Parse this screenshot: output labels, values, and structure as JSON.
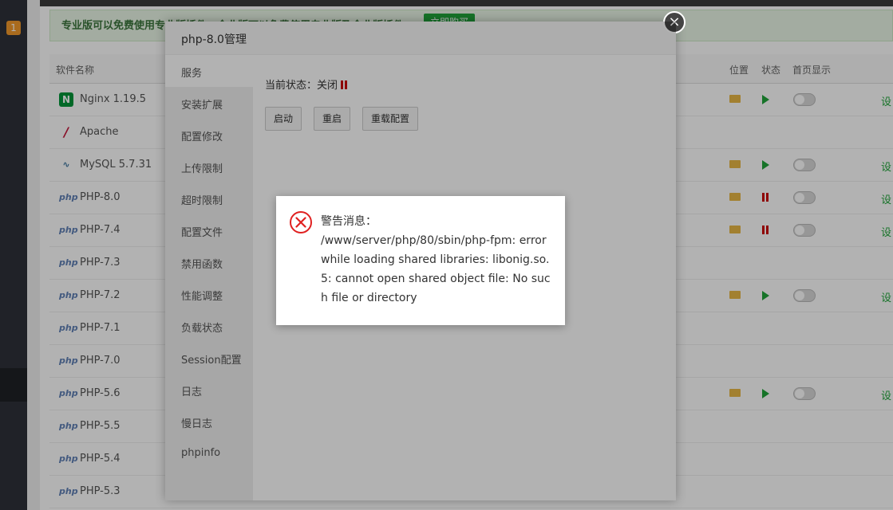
{
  "promo": {
    "text": "专业版可以免费使用专业版插件，企业版可以免费使用专业版及企业版插件",
    "button": "立即购买"
  },
  "leftnav": {
    "badge": "1"
  },
  "table": {
    "headers": {
      "name": "软件名称",
      "location": "位置",
      "state": "状态",
      "home": "首页显示"
    },
    "rows": [
      {
        "name": "Nginx 1.19.5",
        "icon": "nginx-icon",
        "folder": true,
        "state": "running",
        "toggle": true,
        "set": "设"
      },
      {
        "name": "Apache",
        "icon": "apache-icon",
        "folder": false,
        "state": "",
        "toggle": false,
        "set": ""
      },
      {
        "name": "MySQL 5.7.31",
        "icon": "mysql-icon",
        "folder": true,
        "state": "running",
        "toggle": true,
        "set": "设"
      },
      {
        "name": "PHP-8.0",
        "icon": "php-icon",
        "folder": true,
        "state": "stopped",
        "toggle": true,
        "set": "设"
      },
      {
        "name": "PHP-7.4",
        "icon": "php-icon",
        "folder": true,
        "state": "stopped",
        "toggle": true,
        "set": "设"
      },
      {
        "name": "PHP-7.3",
        "icon": "php-icon",
        "folder": false,
        "state": "",
        "toggle": false,
        "set": ""
      },
      {
        "name": "PHP-7.2",
        "icon": "php-icon",
        "folder": true,
        "state": "running",
        "toggle": true,
        "set": "设"
      },
      {
        "name": "PHP-7.1",
        "icon": "php-icon",
        "folder": false,
        "state": "",
        "toggle": false,
        "set": ""
      },
      {
        "name": "PHP-7.0",
        "icon": "php-icon",
        "folder": false,
        "state": "",
        "toggle": false,
        "set": ""
      },
      {
        "name": "PHP-5.6",
        "icon": "php-icon",
        "folder": true,
        "state": "running",
        "toggle": true,
        "set": "设"
      },
      {
        "name": "PHP-5.5",
        "icon": "php-icon",
        "folder": false,
        "state": "",
        "toggle": false,
        "set": ""
      },
      {
        "name": "PHP-5.4",
        "icon": "php-icon",
        "folder": false,
        "state": "",
        "toggle": false,
        "set": ""
      },
      {
        "name": "PHP-5.3",
        "icon": "php-icon",
        "folder": false,
        "state": "",
        "toggle": false,
        "set": ""
      }
    ]
  },
  "modal": {
    "title": "php-8.0管理",
    "close": "×",
    "menu": [
      "服务",
      "安装扩展",
      "配置修改",
      "上传限制",
      "超时限制",
      "配置文件",
      "禁用函数",
      "性能调整",
      "负载状态",
      "Session配置",
      "日志",
      "慢日志",
      "phpinfo"
    ],
    "status_label": "当前状态：关闭",
    "buttons": {
      "start": "启动",
      "restart": "重启",
      "reload": "重载配置"
    }
  },
  "alert": {
    "title": "警告消息：",
    "message": "/www/server/php/80/sbin/php-fpm: error while loading shared libraries: libonig.so.5: cannot open shared object file: No such file or directory"
  },
  "colors": {
    "accent": "#20a53a",
    "error": "#e02020",
    "stop": "#cc0000"
  }
}
